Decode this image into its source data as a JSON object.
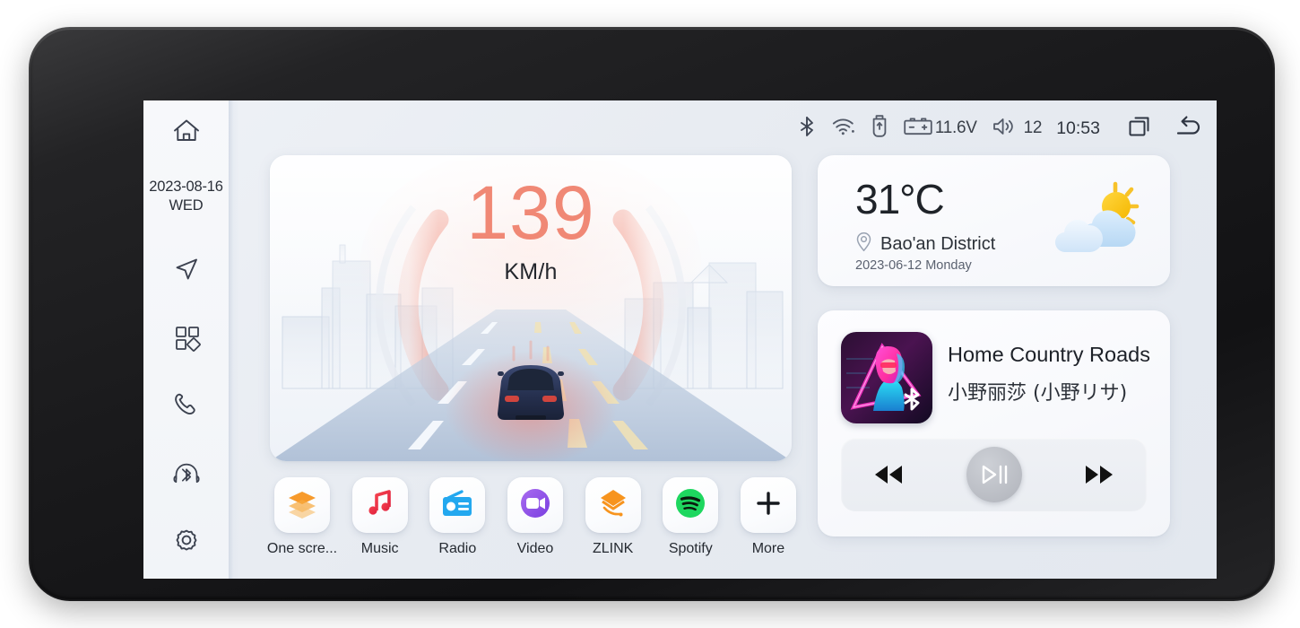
{
  "device": {
    "name": "car-head-unit"
  },
  "sidebar": {
    "date": "2023-08-16",
    "day_of_week": "WED",
    "items": [
      {
        "icon": "home-icon",
        "name": "home"
      },
      {
        "icon": "navigation-icon",
        "name": "navigation"
      },
      {
        "icon": "apps-grid-icon",
        "name": "apps"
      },
      {
        "icon": "phone-icon",
        "name": "phone"
      },
      {
        "icon": "bluetooth-headset-icon",
        "name": "bluetooth-audio"
      },
      {
        "icon": "gear-icon",
        "name": "settings"
      }
    ]
  },
  "statusbar": {
    "bluetooth_icon": "bluetooth-icon",
    "wifi_icon": "wifi-icon",
    "usb_icon": "usb-icon",
    "battery_icon": "car-battery-icon",
    "voltage": "11.6V",
    "volume_icon": "speaker-icon",
    "volume": "12",
    "time": "10:53",
    "recents_icon": "recent-apps-icon",
    "back_icon": "back-arrow-icon"
  },
  "speed_card": {
    "value": "139",
    "unit": "KM/h",
    "accent_color": "#f08875"
  },
  "weather": {
    "temperature": "31°C",
    "location": "Bao'an District",
    "location_icon": "location-pin-icon",
    "date": "2023-06-12 Monday",
    "condition_icon": "partly-cloudy-icon"
  },
  "music": {
    "title": "Home Country Roads",
    "artist": "小野丽莎 (小野リサ)",
    "source_badge_icon": "bluetooth-icon",
    "prev_label": "prev-track",
    "play_label": "play-pause",
    "next_label": "next-track"
  },
  "dock": {
    "apps": [
      {
        "label": "One scre...",
        "icon": "layers-icon",
        "name": "one-screen"
      },
      {
        "label": "Music",
        "icon": "music-note-icon",
        "name": "music"
      },
      {
        "label": "Radio",
        "icon": "radio-icon",
        "name": "radio"
      },
      {
        "label": "Video",
        "icon": "video-camera-icon",
        "name": "video"
      },
      {
        "label": "ZLINK",
        "icon": "zlink-icon",
        "name": "zlink"
      },
      {
        "label": "Spotify",
        "icon": "spotify-icon",
        "name": "spotify"
      },
      {
        "label": "More",
        "icon": "plus-icon",
        "name": "more"
      }
    ]
  },
  "colors": {
    "screen_bg": "#e7ebf1",
    "sidebar_bg": "#f4f6f9",
    "card_bg": "#f8f9fc",
    "accent_speed": "#f08875",
    "text_primary": "#1f2329",
    "text_secondary": "#5b6270"
  }
}
